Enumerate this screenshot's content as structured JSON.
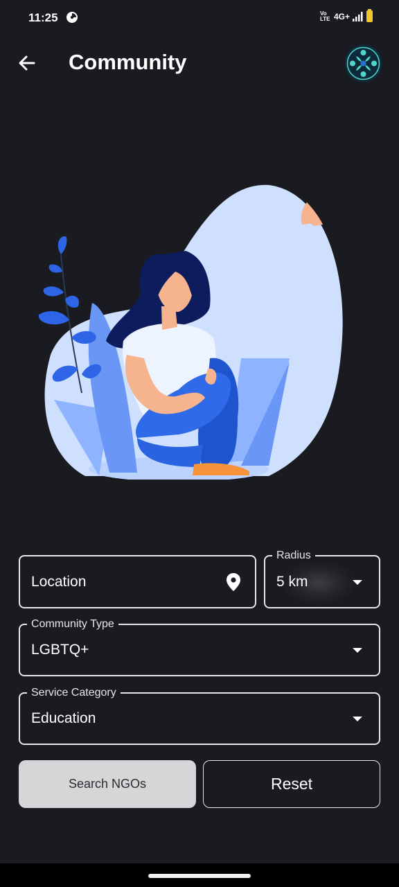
{
  "status_bar": {
    "time": "11:25",
    "volte": "Vo LTE",
    "network": "4G+"
  },
  "app_bar": {
    "title": "Community",
    "back_icon": "arrow-left-icon",
    "logo_icon": "community-logo-icon"
  },
  "illustration": {
    "icon": "person-sitting-illustration"
  },
  "form": {
    "location": {
      "placeholder": "Location",
      "icon": "map-pin-icon"
    },
    "radius": {
      "label": "Radius",
      "value": "5 km"
    },
    "community_type": {
      "label": "Community Type",
      "value": "LGBTQ+"
    },
    "service_category": {
      "label": "Service Category",
      "value": "Education"
    }
  },
  "actions": {
    "search_label": "Search NGOs",
    "reset_label": "Reset"
  },
  "colors": {
    "background": "#1a1b20",
    "accent_blue": "#3f6fe0",
    "light_blue": "#cfe0ff",
    "button_grey": "#d6d6d8",
    "battery": "#f3c530",
    "logo_teal": "#4fd6c8"
  }
}
